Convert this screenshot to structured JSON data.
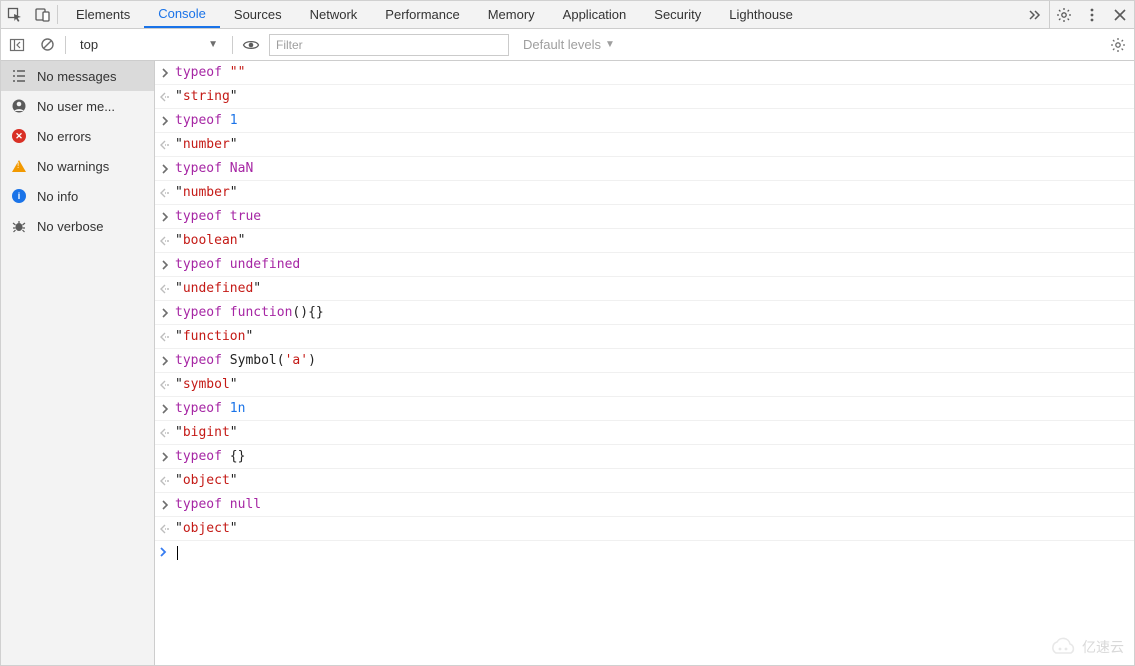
{
  "tabs": {
    "items": [
      "Elements",
      "Console",
      "Sources",
      "Network",
      "Performance",
      "Memory",
      "Application",
      "Security",
      "Lighthouse"
    ],
    "activeIndex": 1
  },
  "subbar": {
    "scope": "top",
    "filter_placeholder": "Filter",
    "levels_label": "Default levels"
  },
  "sidebar": {
    "items": [
      {
        "icon": "list-icon",
        "label": "No messages",
        "active": true
      },
      {
        "icon": "user-icon",
        "label": "No user me..."
      },
      {
        "icon": "error-icon",
        "label": "No errors"
      },
      {
        "icon": "warn-icon",
        "label": "No warnings"
      },
      {
        "icon": "info-icon",
        "label": "No info"
      },
      {
        "icon": "bug-icon",
        "label": "No verbose"
      }
    ]
  },
  "console": {
    "entries": [
      {
        "input": [
          {
            "t": "kw",
            "v": "typeof"
          },
          {
            "t": "sp"
          },
          {
            "t": "str",
            "v": "\"\""
          }
        ],
        "output": "string"
      },
      {
        "input": [
          {
            "t": "kw",
            "v": "typeof"
          },
          {
            "t": "sp"
          },
          {
            "t": "num",
            "v": "1"
          }
        ],
        "output": "number"
      },
      {
        "input": [
          {
            "t": "kw",
            "v": "typeof"
          },
          {
            "t": "sp"
          },
          {
            "t": "kw",
            "v": "NaN"
          }
        ],
        "output": "number"
      },
      {
        "input": [
          {
            "t": "kw",
            "v": "typeof"
          },
          {
            "t": "sp"
          },
          {
            "t": "kw",
            "v": "true"
          }
        ],
        "output": "boolean"
      },
      {
        "input": [
          {
            "t": "kw",
            "v": "typeof"
          },
          {
            "t": "sp"
          },
          {
            "t": "kw",
            "v": "undefined"
          }
        ],
        "output": "undefined"
      },
      {
        "input": [
          {
            "t": "kw",
            "v": "typeof"
          },
          {
            "t": "sp"
          },
          {
            "t": "kw",
            "v": "function"
          },
          {
            "t": "black",
            "v": "(){}"
          }
        ],
        "output": "function"
      },
      {
        "input": [
          {
            "t": "kw",
            "v": "typeof"
          },
          {
            "t": "sp"
          },
          {
            "t": "black",
            "v": "Symbol("
          },
          {
            "t": "str",
            "v": "'a'"
          },
          {
            "t": "black",
            "v": ")"
          }
        ],
        "output": "symbol"
      },
      {
        "input": [
          {
            "t": "kw",
            "v": "typeof"
          },
          {
            "t": "sp"
          },
          {
            "t": "num",
            "v": "1n"
          }
        ],
        "output": "bigint"
      },
      {
        "input": [
          {
            "t": "kw",
            "v": "typeof"
          },
          {
            "t": "sp"
          },
          {
            "t": "black",
            "v": "{}"
          }
        ],
        "output": "object"
      },
      {
        "input": [
          {
            "t": "kw",
            "v": "typeof"
          },
          {
            "t": "sp"
          },
          {
            "t": "kw",
            "v": "null"
          }
        ],
        "output": "object"
      }
    ]
  },
  "watermark": "亿速云"
}
